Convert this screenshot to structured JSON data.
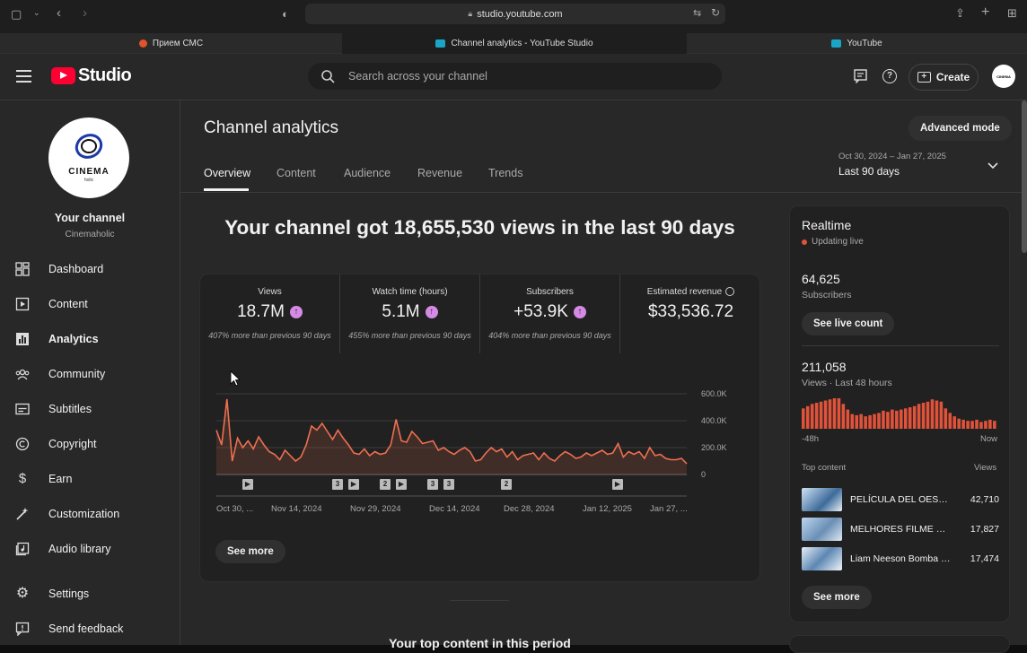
{
  "browser": {
    "url": "studio.youtube.com",
    "tabs": [
      {
        "label": "Прием СМС",
        "color": "#e0532b"
      },
      {
        "label": "Channel analytics - YouTube Studio",
        "color": "#1aa5c7"
      },
      {
        "label": "YouTube",
        "color": "#1aa5c7"
      }
    ]
  },
  "header": {
    "logo_text": "Studio",
    "search_placeholder": "Search across your channel",
    "create_label": "Create",
    "avatar_text": "CINEMA"
  },
  "sidebar": {
    "channel_logo_text": "CINEMA",
    "channel_logo_sub": "holic",
    "channel_label": "Your channel",
    "channel_name": "Cinemaholic",
    "items": [
      {
        "label": "Dashboard",
        "icon": "dashboard-icon"
      },
      {
        "label": "Content",
        "icon": "content-icon"
      },
      {
        "label": "Analytics",
        "icon": "analytics-icon",
        "active": true
      },
      {
        "label": "Community",
        "icon": "community-icon"
      },
      {
        "label": "Subtitles",
        "icon": "subtitles-icon"
      },
      {
        "label": "Copyright",
        "icon": "copyright-icon"
      },
      {
        "label": "Earn",
        "icon": "earn-icon"
      },
      {
        "label": "Customization",
        "icon": "customization-icon"
      },
      {
        "label": "Audio library",
        "icon": "audio-library-icon"
      }
    ],
    "settings_label": "Settings",
    "feedback_label": "Send feedback"
  },
  "main": {
    "title": "Channel analytics",
    "advanced_mode": "Advanced mode",
    "tabs": [
      "Overview",
      "Content",
      "Audience",
      "Revenue",
      "Trends"
    ],
    "date_range": "Oct 30, 2024 – Jan 27, 2025",
    "period_label": "Last 90 days",
    "headline": "Your channel got 18,655,530 views in the last 90 days",
    "metrics": [
      {
        "label": "Views",
        "value": "18.7M",
        "sub": "407% more than previous 90 days",
        "up": true
      },
      {
        "label": "Watch time (hours)",
        "value": "5.1M",
        "sub": "455% more than previous 90 days",
        "up": true
      },
      {
        "label": "Subscribers",
        "value": "+53.9K",
        "sub": "404% more than previous 90 days",
        "up": true
      },
      {
        "label": "Estimated revenue",
        "value": "$33,536.72",
        "sub": "",
        "up": false
      }
    ],
    "see_more": "See more",
    "top_content_heading": "Your top content in this period"
  },
  "chart_data": {
    "type": "area",
    "x_tick_labels": [
      "Oct 30, ...",
      "Nov 14, 2024",
      "Nov 29, 2024",
      "Dec 14, 2024",
      "Dec 28, 2024",
      "Jan 12, 2025",
      "Jan 27, ..."
    ],
    "y_tick_labels": [
      "600.0K",
      "400.0K",
      "200.0K",
      "0"
    ],
    "ylim": [
      0,
      600000
    ],
    "series": [
      {
        "values": [
          330000,
          220000,
          560000,
          100000,
          270000,
          200000,
          250000,
          190000,
          280000,
          220000,
          170000,
          150000,
          110000,
          180000,
          140000,
          100000,
          130000,
          220000,
          360000,
          330000,
          380000,
          320000,
          260000,
          330000,
          270000,
          220000,
          160000,
          150000,
          190000,
          140000,
          170000,
          150000,
          160000,
          220000,
          410000,
          250000,
          240000,
          320000,
          280000,
          230000,
          240000,
          250000,
          180000,
          200000,
          170000,
          150000,
          180000,
          200000,
          170000,
          100000,
          110000,
          160000,
          200000,
          170000,
          190000,
          130000,
          170000,
          110000,
          140000,
          150000,
          160000,
          110000,
          160000,
          120000,
          100000,
          140000,
          170000,
          150000,
          120000,
          130000,
          160000,
          140000,
          160000,
          180000,
          150000,
          160000,
          230000,
          130000,
          170000,
          150000,
          170000,
          120000,
          200000,
          140000,
          150000,
          120000,
          110000,
          110000,
          120000,
          80000
        ],
        "color": "#ee6f4f"
      }
    ],
    "markers": [
      "",
      "3",
      "",
      "2",
      "",
      "3",
      "3",
      "2",
      ""
    ],
    "grid": true
  },
  "realtime": {
    "title": "Realtime",
    "status": "Updating live",
    "subscribers_value": "64,625",
    "subscribers_label": "Subscribers",
    "see_live_count": "See live count",
    "views_value": "211,058",
    "views_label": "Views · Last 48 hours",
    "bars": [
      18,
      20,
      22,
      23,
      24,
      25,
      26,
      27,
      27,
      22,
      17,
      13,
      12,
      13,
      11,
      12,
      13,
      14,
      16,
      15,
      17,
      16,
      17,
      18,
      19,
      20,
      22,
      23,
      24,
      26,
      25,
      24,
      18,
      14,
      11,
      9,
      8,
      7,
      7,
      8,
      6,
      7,
      8,
      7
    ],
    "x_start": "-48h",
    "x_end": "Now",
    "top_content_label": "Top content",
    "views_col_label": "Views",
    "items": [
      {
        "title": "PELÍCULA DEL OESTE ...",
        "views": "42,710"
      },
      {
        "title": "MELHORES FILME DE ...",
        "views": "17,827"
      },
      {
        "title": "Liam Neeson Bomba d...",
        "views": "17,474"
      }
    ],
    "see_more": "See more",
    "bar_color": "#e0533a",
    "live_color": "#e0533a"
  }
}
